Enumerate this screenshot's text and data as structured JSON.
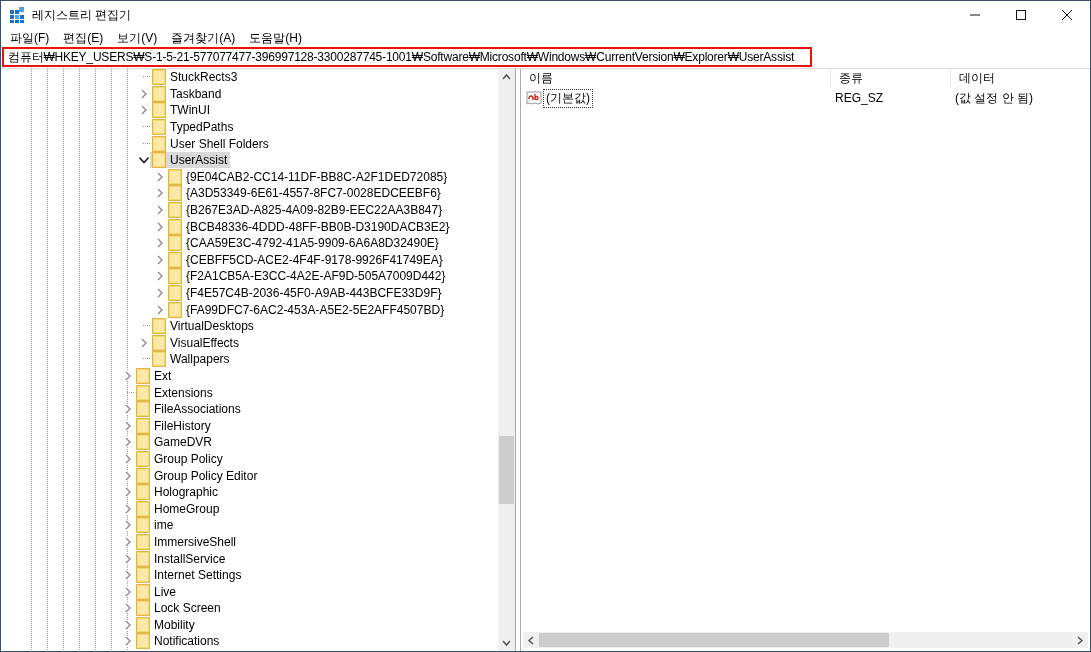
{
  "window": {
    "title": "레지스트리 편집기"
  },
  "menu": [
    "파일(F)",
    "편집(E)",
    "보기(V)",
    "즐겨찾기(A)",
    "도움말(H)"
  ],
  "address": {
    "path": "컴퓨터₩HKEY_USERS₩S-1-5-21-577077477-396997128-3300287745-1001₩Software₩Microsoft₩Windows₩CurrentVersion₩Explorer₩UserAssist",
    "highlighted": true
  },
  "tree": {
    "explorer_subkeys": [
      {
        "label": "StuckRects3",
        "expandable": false,
        "selected": false
      },
      {
        "label": "Taskband",
        "expandable": true,
        "expanded": false,
        "selected": false
      },
      {
        "label": "TWinUI",
        "expandable": true,
        "expanded": false,
        "selected": false
      },
      {
        "label": "TypedPaths",
        "expandable": false,
        "selected": false
      },
      {
        "label": "User Shell Folders",
        "expandable": false,
        "selected": false
      },
      {
        "label": "UserAssist",
        "expandable": true,
        "expanded": true,
        "selected": true,
        "children": [
          {
            "label": "{9E04CAB2-CC14-11DF-BB8C-A2F1DED72085}",
            "expandable": true,
            "expanded": false,
            "selected": false
          },
          {
            "label": "{A3D53349-6E61-4557-8FC7-0028EDCEEBF6}",
            "expandable": true,
            "expanded": false,
            "selected": false
          },
          {
            "label": "{B267E3AD-A825-4A09-82B9-EEC22AA3B847}",
            "expandable": true,
            "expanded": false,
            "selected": false
          },
          {
            "label": "{BCB48336-4DDD-48FF-BB0B-D3190DACB3E2}",
            "expandable": true,
            "expanded": false,
            "selected": false
          },
          {
            "label": "{CAA59E3C-4792-41A5-9909-6A6A8D32490E}",
            "expandable": true,
            "expanded": false,
            "selected": false
          },
          {
            "label": "{CEBFF5CD-ACE2-4F4F-9178-9926F41749EA}",
            "expandable": true,
            "expanded": false,
            "selected": false
          },
          {
            "label": "{F2A1CB5A-E3CC-4A2E-AF9D-505A7009D442}",
            "expandable": true,
            "expanded": false,
            "selected": false
          },
          {
            "label": "{F4E57C4B-2036-45F0-A9AB-443BCFE33D9F}",
            "expandable": true,
            "expanded": false,
            "selected": false
          },
          {
            "label": "{FA99DFC7-6AC2-453A-A5E2-5E2AFF4507BD}",
            "expandable": true,
            "expanded": false,
            "selected": false
          }
        ]
      },
      {
        "label": "VirtualDesktops",
        "expandable": false,
        "selected": false
      },
      {
        "label": "VisualEffects",
        "expandable": true,
        "expanded": false,
        "selected": false
      },
      {
        "label": "Wallpapers",
        "expandable": false,
        "selected": false
      }
    ],
    "sibling_keys": [
      {
        "label": "Ext",
        "expandable": true,
        "expanded": false,
        "selected": false
      },
      {
        "label": "Extensions",
        "expandable": false,
        "selected": false
      },
      {
        "label": "FileAssociations",
        "expandable": true,
        "expanded": false,
        "selected": false
      },
      {
        "label": "FileHistory",
        "expandable": true,
        "expanded": false,
        "selected": false
      },
      {
        "label": "GameDVR",
        "expandable": true,
        "expanded": false,
        "selected": false
      },
      {
        "label": "Group Policy",
        "expandable": true,
        "expanded": false,
        "selected": false
      },
      {
        "label": "Group Policy Editor",
        "expandable": true,
        "expanded": false,
        "selected": false
      },
      {
        "label": "Holographic",
        "expandable": true,
        "expanded": false,
        "selected": false
      },
      {
        "label": "HomeGroup",
        "expandable": true,
        "expanded": false,
        "selected": false
      },
      {
        "label": "ime",
        "expandable": true,
        "expanded": false,
        "selected": false
      },
      {
        "label": "ImmersiveShell",
        "expandable": true,
        "expanded": false,
        "selected": false
      },
      {
        "label": "InstallService",
        "expandable": true,
        "expanded": false,
        "selected": false
      },
      {
        "label": "Internet Settings",
        "expandable": true,
        "expanded": false,
        "selected": false
      },
      {
        "label": "Live",
        "expandable": true,
        "expanded": false,
        "selected": false
      },
      {
        "label": "Lock Screen",
        "expandable": true,
        "expanded": false,
        "selected": false
      },
      {
        "label": "Mobility",
        "expandable": true,
        "expanded": false,
        "selected": false
      },
      {
        "label": "Notifications",
        "expandable": true,
        "expanded": false,
        "selected": false
      }
    ]
  },
  "values": {
    "columns": [
      "이름",
      "종류",
      "데이터"
    ],
    "rows": [
      {
        "name": "(기본값)",
        "type": "REG_SZ",
        "data": "(값 설정 안 됨)",
        "selected": true
      }
    ]
  }
}
